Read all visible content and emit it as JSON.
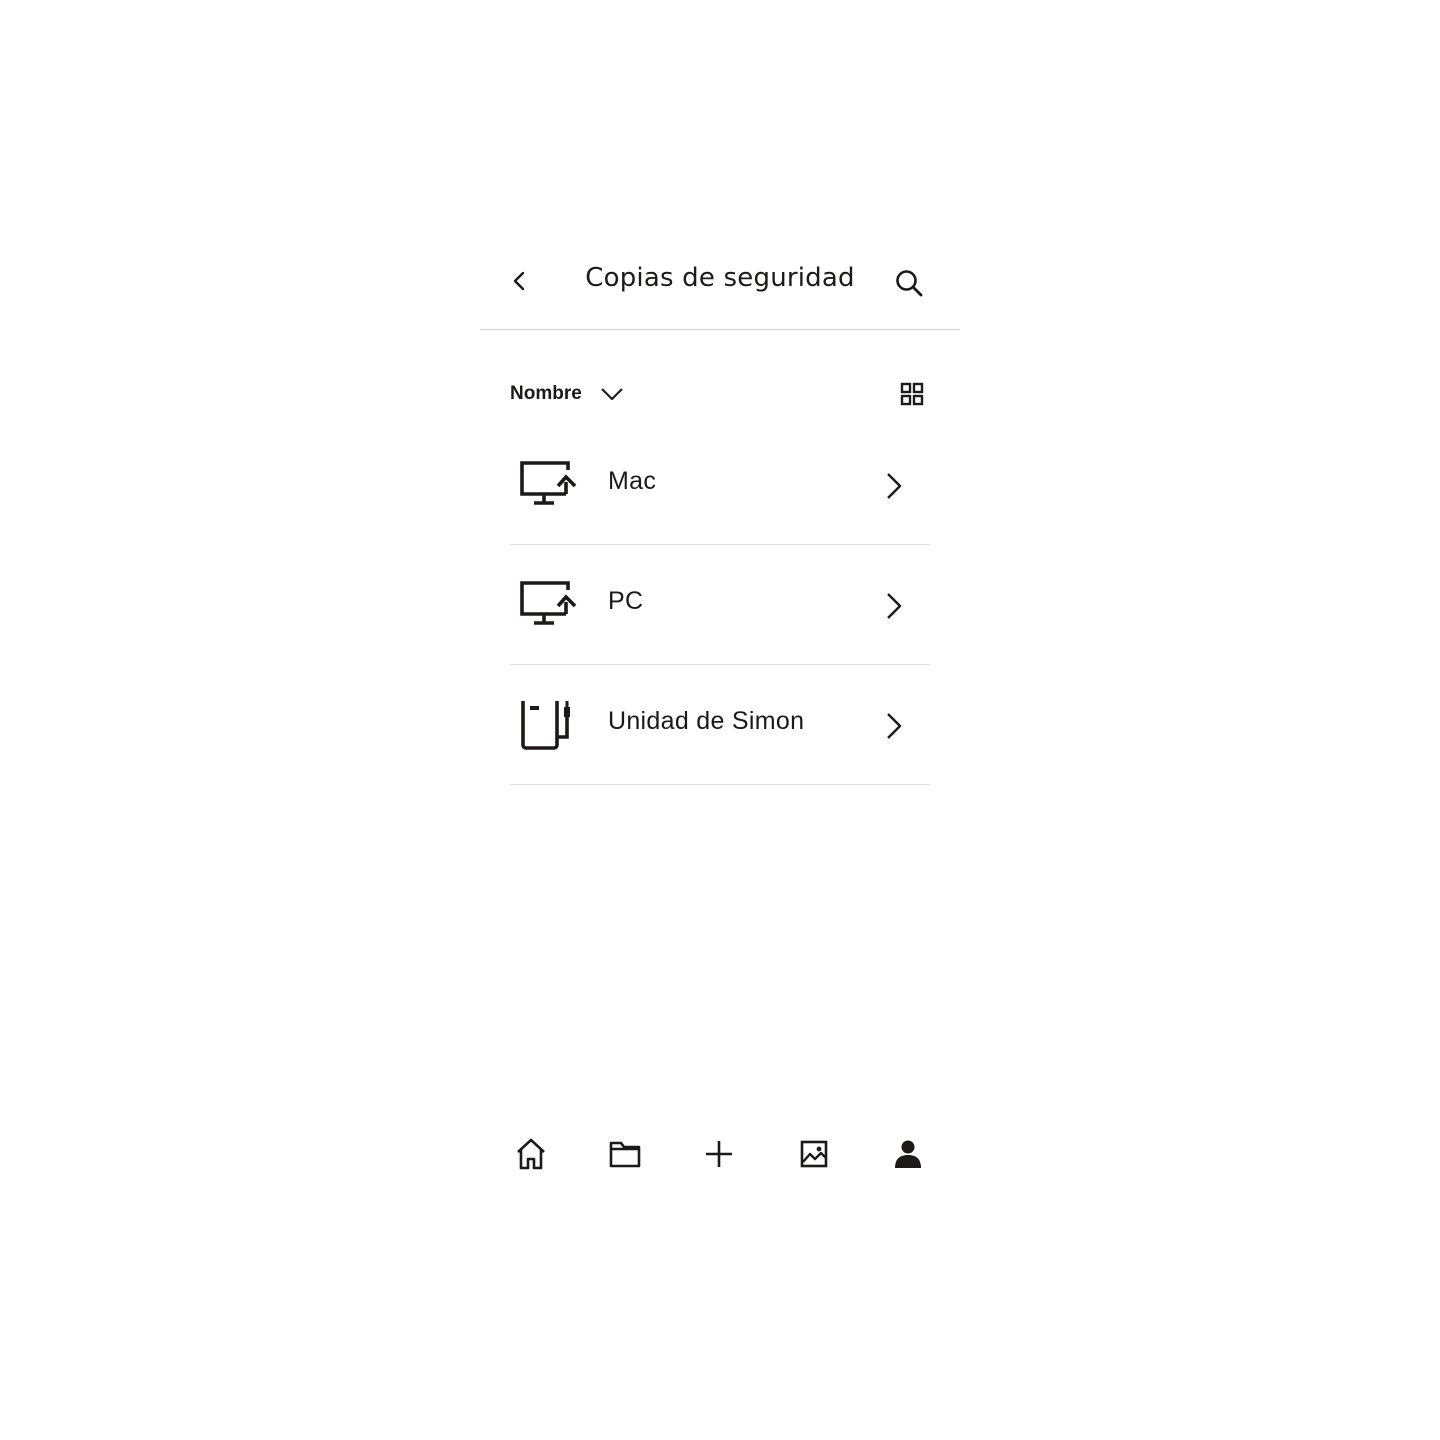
{
  "header": {
    "title": "Copias de seguridad",
    "back_icon": "chevron-left-icon",
    "search_icon": "search-icon"
  },
  "toolbar": {
    "sort_label": "Nombre",
    "sort_icon": "chevron-down-icon",
    "view_icon": "grid-view-icon"
  },
  "items": [
    {
      "label": "Mac",
      "icon": "computer-backup-icon"
    },
    {
      "label": "PC",
      "icon": "computer-backup-icon"
    },
    {
      "label": "Unidad de Simon",
      "icon": "external-drive-icon"
    }
  ],
  "bottom_nav": [
    {
      "name": "home",
      "icon": "home-icon"
    },
    {
      "name": "files",
      "icon": "folder-icon"
    },
    {
      "name": "create",
      "icon": "plus-icon"
    },
    {
      "name": "photos",
      "icon": "photo-icon"
    },
    {
      "name": "account",
      "icon": "account-icon"
    }
  ],
  "colors": {
    "text": "#1e1919",
    "divider": "#e1e1e1",
    "background": "#ffffff"
  }
}
